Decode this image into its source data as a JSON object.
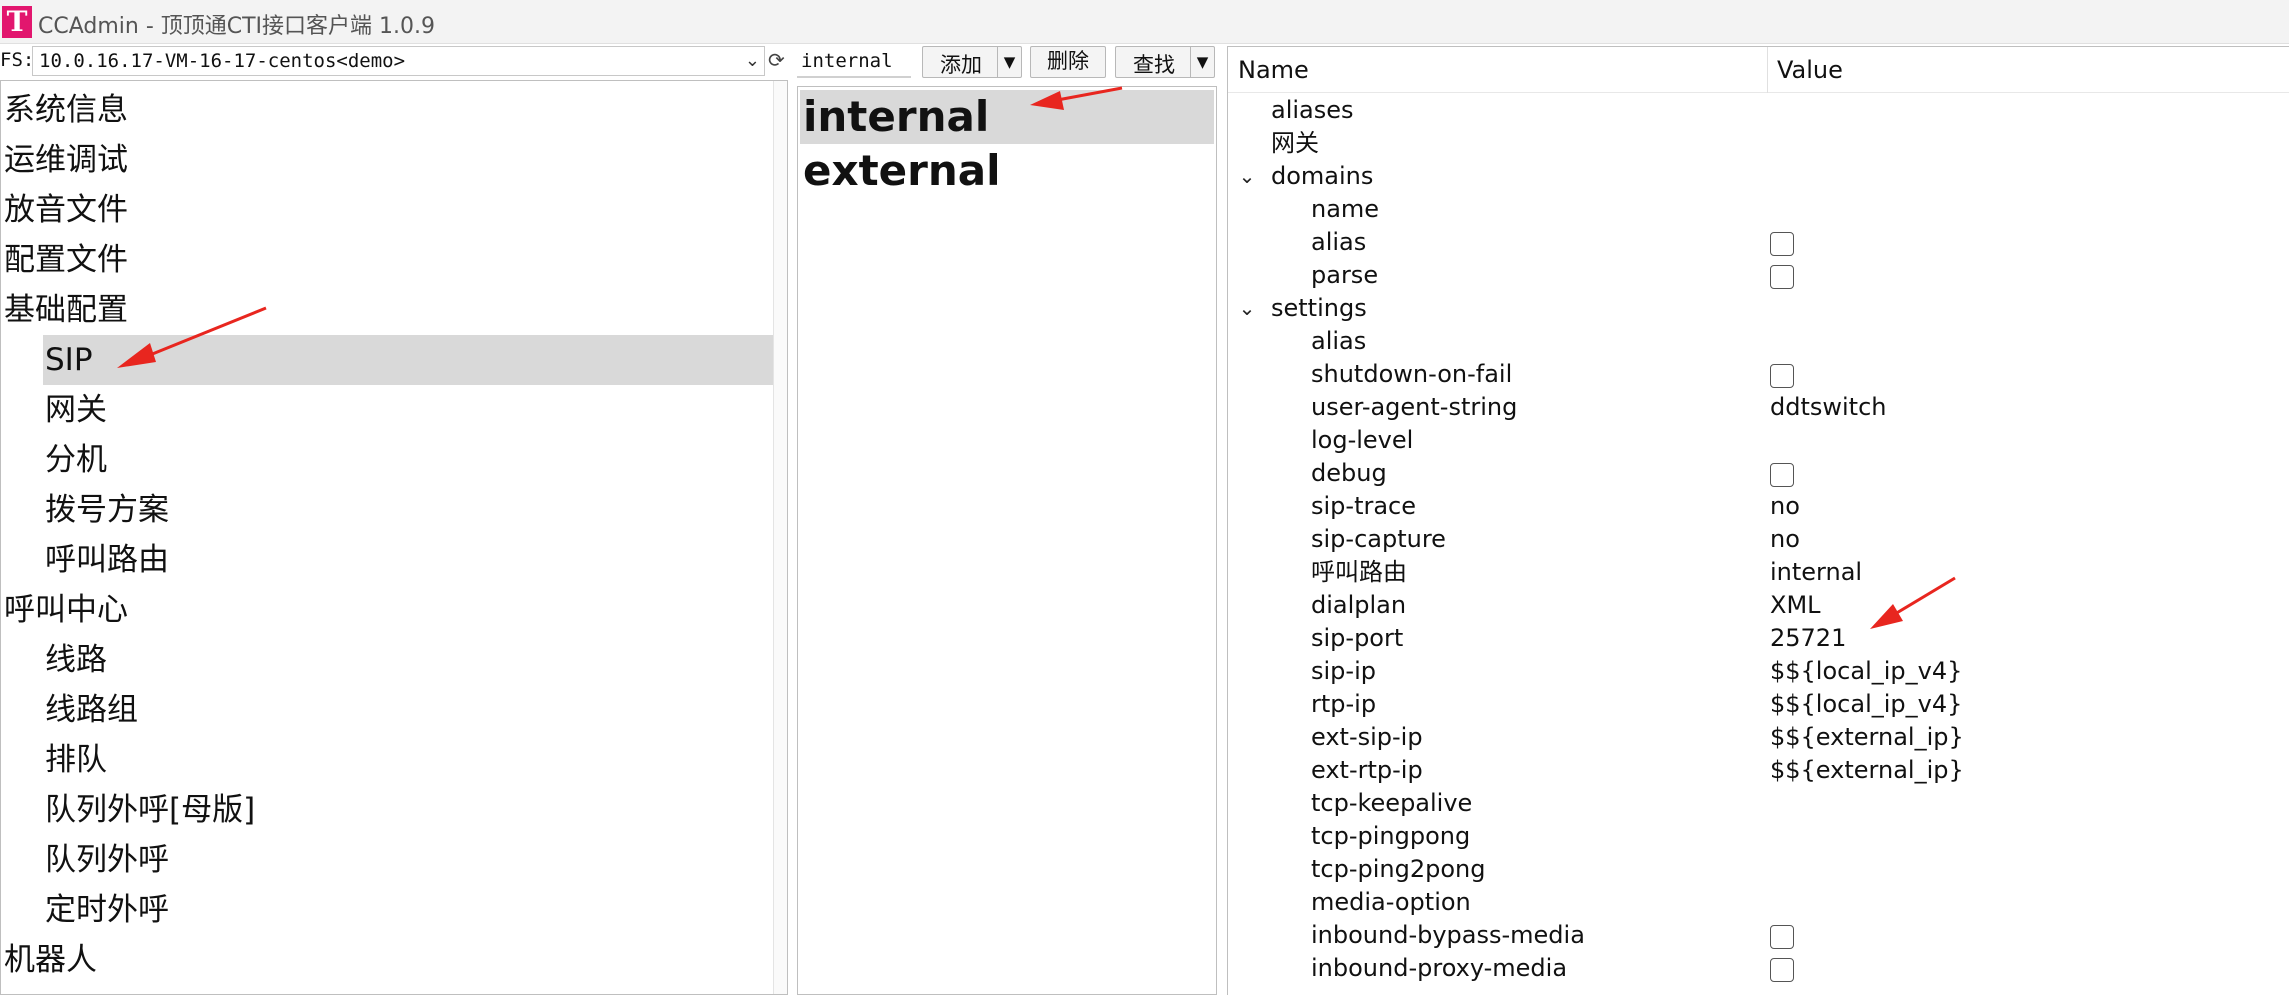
{
  "window": {
    "logo": "T",
    "title": "CCAdmin - 顶顶通CTI接口客户端 1.0.9"
  },
  "left": {
    "fs_label": "FS:",
    "server": "10.0.16.17-VM-16-17-centos<demo>",
    "tree": [
      {
        "label": "系统信息",
        "level": 0,
        "selected": false
      },
      {
        "label": "运维调试",
        "level": 0,
        "selected": false
      },
      {
        "label": "放音文件",
        "level": 0,
        "selected": false
      },
      {
        "label": "配置文件",
        "level": 0,
        "selected": false
      },
      {
        "label": "基础配置",
        "level": 0,
        "selected": false
      },
      {
        "label": "SIP",
        "level": 1,
        "selected": true
      },
      {
        "label": "网关",
        "level": 1,
        "selected": false
      },
      {
        "label": "分机",
        "level": 1,
        "selected": false
      },
      {
        "label": "拨号方案",
        "level": 1,
        "selected": false
      },
      {
        "label": "呼叫路由",
        "level": 1,
        "selected": false
      },
      {
        "label": "呼叫中心",
        "level": 0,
        "selected": false
      },
      {
        "label": "线路",
        "level": 1,
        "selected": false
      },
      {
        "label": "线路组",
        "level": 1,
        "selected": false
      },
      {
        "label": "排队",
        "level": 1,
        "selected": false
      },
      {
        "label": "队列外呼[母版]",
        "level": 1,
        "selected": false
      },
      {
        "label": "队列外呼",
        "level": 1,
        "selected": false
      },
      {
        "label": "定时外呼",
        "level": 1,
        "selected": false
      },
      {
        "label": "机器人",
        "level": 0,
        "selected": false
      }
    ]
  },
  "middle": {
    "search_value": "internal",
    "add_label": "添加",
    "delete_label": "删除",
    "find_label": "查找",
    "profiles": [
      {
        "label": "internal",
        "selected": true
      },
      {
        "label": "external",
        "selected": false
      }
    ]
  },
  "properties": {
    "name_header": "Name",
    "value_header": "Value",
    "rows": [
      {
        "name": "aliases",
        "indent": 1,
        "value": ""
      },
      {
        "name": "网关",
        "indent": 1,
        "value": ""
      },
      {
        "name": "domains",
        "indent": 1,
        "expander": true,
        "value": ""
      },
      {
        "name": "name",
        "indent": 2,
        "value": ""
      },
      {
        "name": "alias",
        "indent": 2,
        "checkbox": true,
        "checked": false
      },
      {
        "name": "parse",
        "indent": 2,
        "checkbox": true,
        "checked": false
      },
      {
        "name": "settings",
        "indent": 1,
        "expander": true,
        "value": ""
      },
      {
        "name": "alias",
        "indent": 2,
        "value": ""
      },
      {
        "name": "shutdown-on-fail",
        "indent": 2,
        "checkbox": true,
        "checked": false
      },
      {
        "name": "user-agent-string",
        "indent": 2,
        "value": "ddtswitch"
      },
      {
        "name": "log-level",
        "indent": 2,
        "value": ""
      },
      {
        "name": "debug",
        "indent": 2,
        "checkbox": true,
        "checked": false
      },
      {
        "name": "sip-trace",
        "indent": 2,
        "value": "no"
      },
      {
        "name": "sip-capture",
        "indent": 2,
        "value": "no"
      },
      {
        "name": "呼叫路由",
        "indent": 2,
        "value": "internal"
      },
      {
        "name": "dialplan",
        "indent": 2,
        "value": "XML"
      },
      {
        "name": "sip-port",
        "indent": 2,
        "value": "25721"
      },
      {
        "name": "sip-ip",
        "indent": 2,
        "value": "$${local_ip_v4}"
      },
      {
        "name": "rtp-ip",
        "indent": 2,
        "value": "$${local_ip_v4}"
      },
      {
        "name": "ext-sip-ip",
        "indent": 2,
        "value": "$${external_ip}"
      },
      {
        "name": "ext-rtp-ip",
        "indent": 2,
        "value": "$${external_ip}"
      },
      {
        "name": "tcp-keepalive",
        "indent": 2,
        "value": ""
      },
      {
        "name": "tcp-pingpong",
        "indent": 2,
        "value": ""
      },
      {
        "name": "tcp-ping2pong",
        "indent": 2,
        "value": ""
      },
      {
        "name": "media-option",
        "indent": 2,
        "value": ""
      },
      {
        "name": "inbound-bypass-media",
        "indent": 2,
        "checkbox": true,
        "checked": false
      },
      {
        "name": "inbound-proxy-media",
        "indent": 2,
        "checkbox": true,
        "checked": false
      }
    ]
  },
  "annotation_color": "#e8261f"
}
